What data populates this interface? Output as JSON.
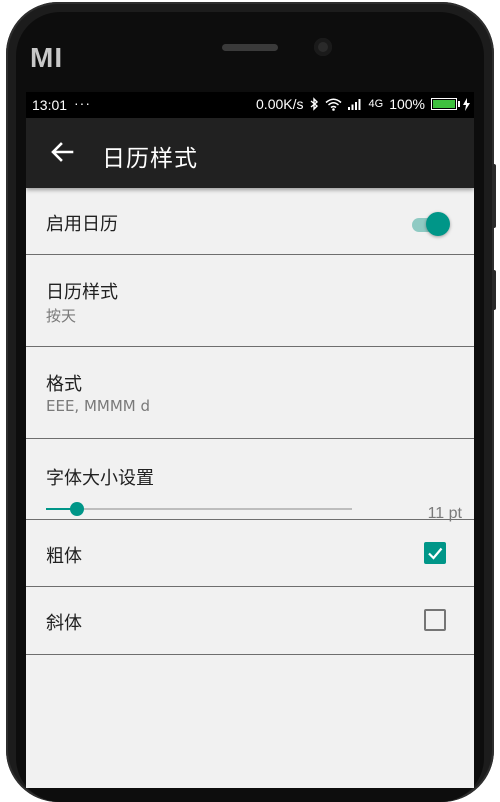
{
  "device": {
    "brand": "MI"
  },
  "status_bar": {
    "time": "13:01",
    "notification_dots": "···",
    "speed": "0.00K/s",
    "network": "4G",
    "battery": "100%",
    "battery_level": 1.0
  },
  "app_bar": {
    "title": "日历样式",
    "back_icon": "arrow-left-icon"
  },
  "settings": {
    "enable_calendar": {
      "label": "启用日历",
      "enabled": true
    },
    "calendar_style": {
      "label": "日历样式",
      "value": "按天"
    },
    "format": {
      "label": "格式",
      "value": "EEE, MMMM d"
    },
    "font_size": {
      "label": "字体大小设置",
      "value_text": "11 pt",
      "slider_fraction": 0.1
    },
    "bold": {
      "label": "粗体",
      "checked": true
    },
    "italic": {
      "label": "斜体",
      "checked": false
    }
  },
  "colors": {
    "accent": "#009688",
    "app_bar": "#212121",
    "background": "#f1f1f1"
  }
}
